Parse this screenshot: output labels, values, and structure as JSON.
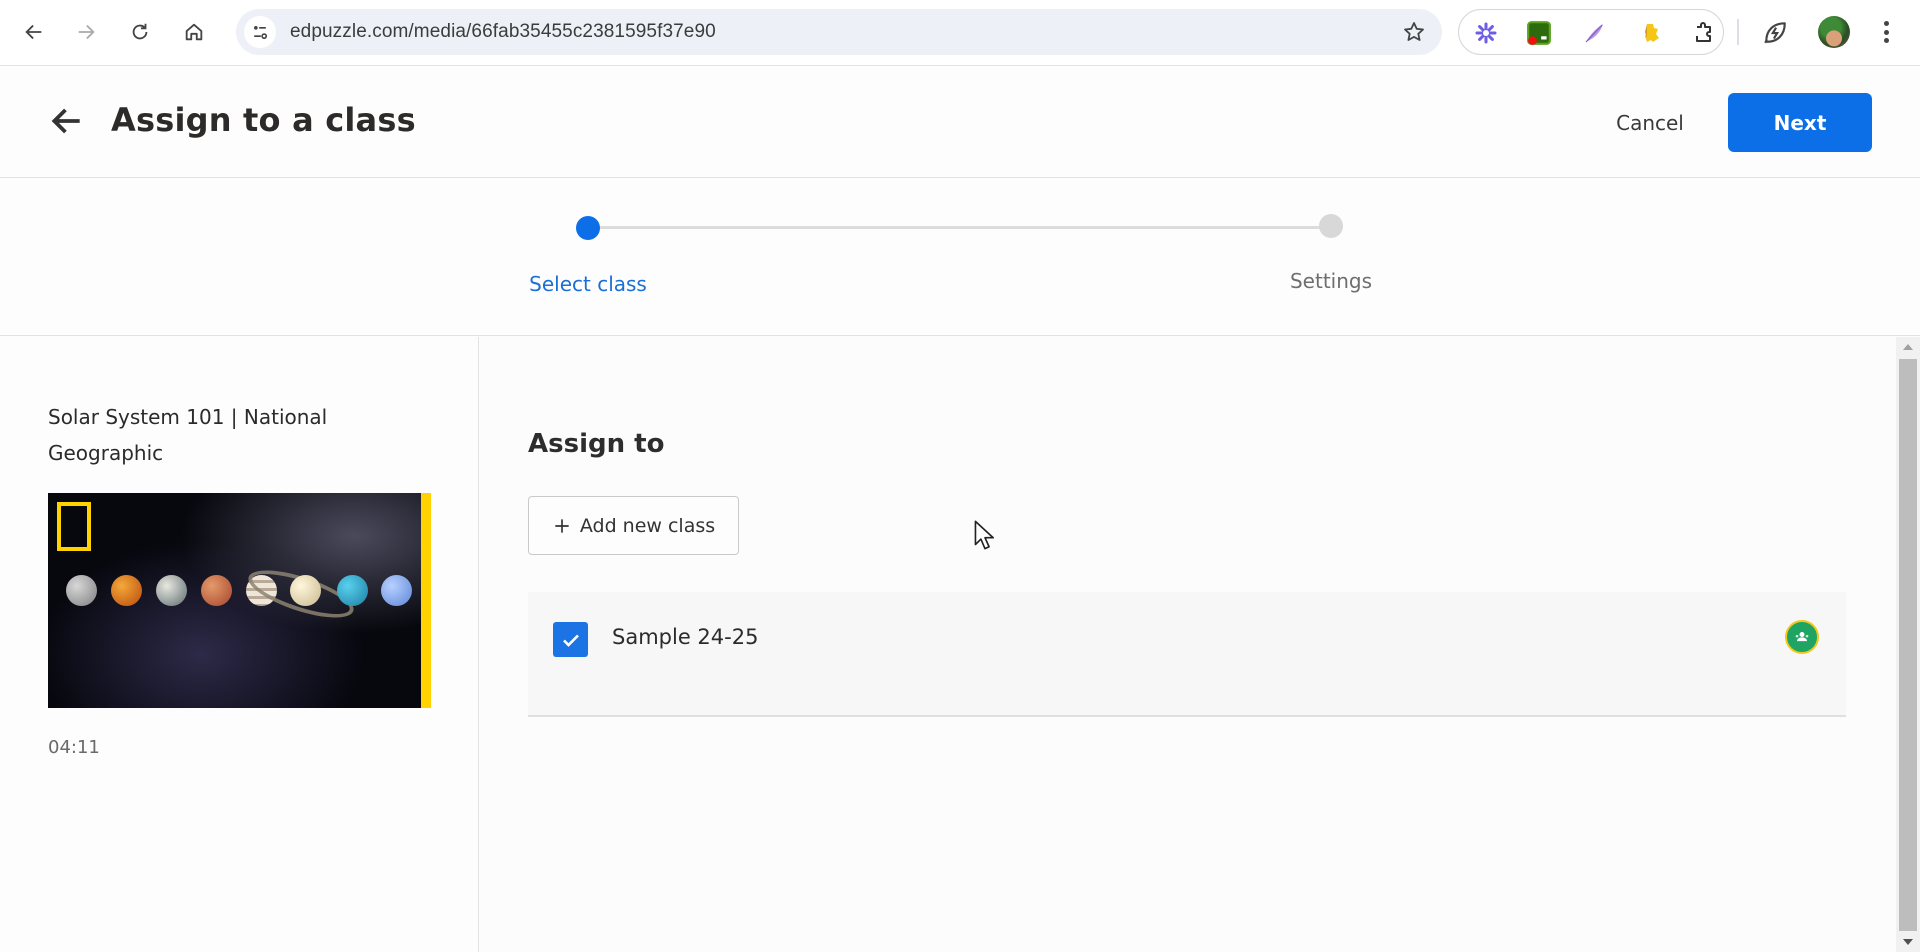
{
  "browser": {
    "url": "edpuzzle.com/media/66fab35455c2381595f37e90",
    "extensions": [
      "sparkle-icon",
      "classroom-screen-icon",
      "quill-icon",
      "puzzle-piece-yellow-icon",
      "extensions-icon"
    ],
    "colors": {
      "omnibox": "#edf0f6"
    }
  },
  "header": {
    "title": "Assign to a class",
    "cancel_label": "Cancel",
    "next_label": "Next"
  },
  "stepper": {
    "steps": [
      {
        "label": "Select class",
        "state": "active"
      },
      {
        "label": "Settings",
        "state": "inactive"
      }
    ],
    "current_step": 1,
    "total_steps": 2
  },
  "video": {
    "title": "Solar System 101 | National Geographic",
    "duration": "04:11"
  },
  "assign": {
    "heading": "Assign to",
    "add_class_label": "Add new class",
    "classes": [
      {
        "name": "Sample 24-25",
        "checked": true,
        "source": "google-classroom"
      }
    ]
  },
  "colors": {
    "primary": "#0c6fe8",
    "checkbox": "#1c74e4",
    "active_step_text": "#1a6fd6",
    "classroom_green": "#1fa463",
    "natgeo_yellow": "#ffd200"
  }
}
